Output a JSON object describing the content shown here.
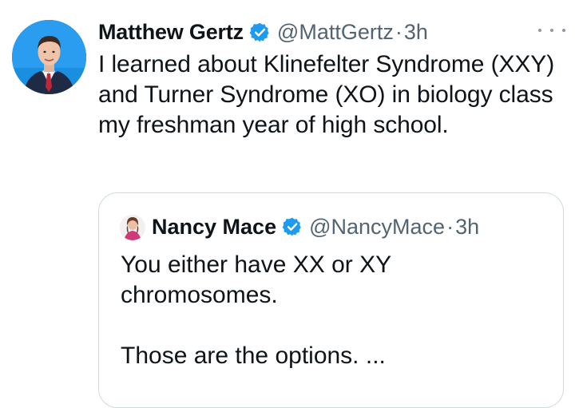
{
  "tweet": {
    "author_name": "Matthew Gertz",
    "handle": "@MattGertz",
    "separator": "·",
    "time": "3h",
    "text": "I learned about Klinefelter Syndrome (XXY) and Turner Syndrome (XO) in biology class my freshman year of high school.",
    "verified_color": "#1d9bf0",
    "avatar_icon": "user-avatar-icon",
    "more_icon": "more-options-icon"
  },
  "quote": {
    "author_name": "Nancy Mace",
    "handle": "@NancyMace",
    "separator": "·",
    "time": "3h",
    "text_line1": "You either have XX or XY chromosomes.",
    "text_line2": "Those are the options. ...",
    "verified_color": "#1d9bf0",
    "avatar_icon": "user-avatar-icon"
  }
}
